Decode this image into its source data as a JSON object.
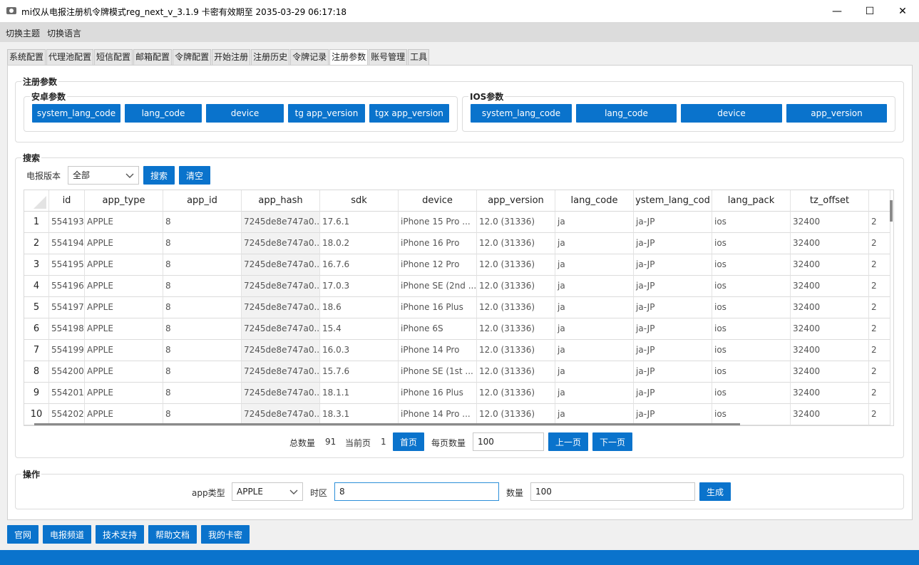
{
  "window": {
    "title": "mi仅从电报注册机令牌模式reg_next_v_3.1.9 卡密有效期至 2035-03-29 06:17:18",
    "minimize": "—",
    "maximize": "☐",
    "close": "✕"
  },
  "menu": [
    "切换主题",
    "切换语言"
  ],
  "tabs": [
    "系统配置",
    "代理池配置",
    "短信配置",
    "邮箱配置",
    "令牌配置",
    "开始注册",
    "注册历史",
    "令牌记录",
    "注册参数",
    "账号管理",
    "工具"
  ],
  "active_tab": "注册参数",
  "register_params": {
    "title": "注册参数",
    "android": {
      "title": "安卓参数",
      "buttons": [
        "system_lang_code",
        "lang_code",
        "device",
        "tg app_version",
        "tgx app_version"
      ]
    },
    "ios": {
      "title": "IOS参数",
      "buttons": [
        "system_lang_code",
        "lang_code",
        "device",
        "app_version"
      ]
    }
  },
  "search": {
    "title": "搜索",
    "version_label": "电报版本",
    "version_value": "全部",
    "search_button": "搜索",
    "clear_button": "清空"
  },
  "table": {
    "columns": [
      "id",
      "app_type",
      "app_id",
      "app_hash",
      "sdk",
      "device",
      "app_version",
      "lang_code",
      "ystem_lang_cod",
      "lang_pack",
      "tz_offset"
    ],
    "rows": [
      {
        "n": "1",
        "cells": [
          "554193",
          "APPLE",
          "8",
          "7245de8e747a0...",
          "17.6.1",
          "iPhone 15 Pro ...",
          "12.0 (31336)",
          "ja",
          "ja-JP",
          "ios",
          "32400",
          "2"
        ]
      },
      {
        "n": "2",
        "cells": [
          "554194",
          "APPLE",
          "8",
          "7245de8e747a0...",
          "18.0.2",
          "iPhone 16 Pro",
          "12.0 (31336)",
          "ja",
          "ja-JP",
          "ios",
          "32400",
          "2"
        ]
      },
      {
        "n": "3",
        "cells": [
          "554195",
          "APPLE",
          "8",
          "7245de8e747a0...",
          "16.7.6",
          "iPhone 12 Pro",
          "12.0 (31336)",
          "ja",
          "ja-JP",
          "ios",
          "32400",
          "2"
        ]
      },
      {
        "n": "4",
        "cells": [
          "554196",
          "APPLE",
          "8",
          "7245de8e747a0...",
          "17.0.3",
          "iPhone SE (2nd ...",
          "12.0 (31336)",
          "ja",
          "ja-JP",
          "ios",
          "32400",
          "2"
        ]
      },
      {
        "n": "5",
        "cells": [
          "554197",
          "APPLE",
          "8",
          "7245de8e747a0...",
          "18.6",
          "iPhone 16 Plus",
          "12.0 (31336)",
          "ja",
          "ja-JP",
          "ios",
          "32400",
          "2"
        ]
      },
      {
        "n": "6",
        "cells": [
          "554198",
          "APPLE",
          "8",
          "7245de8e747a0...",
          "15.4",
          "iPhone 6S",
          "12.0 (31336)",
          "ja",
          "ja-JP",
          "ios",
          "32400",
          "2"
        ]
      },
      {
        "n": "7",
        "cells": [
          "554199",
          "APPLE",
          "8",
          "7245de8e747a0...",
          "16.0.3",
          "iPhone 14 Pro",
          "12.0 (31336)",
          "ja",
          "ja-JP",
          "ios",
          "32400",
          "2"
        ]
      },
      {
        "n": "8",
        "cells": [
          "554200",
          "APPLE",
          "8",
          "7245de8e747a0...",
          "15.7.6",
          "iPhone SE (1st ...",
          "12.0 (31336)",
          "ja",
          "ja-JP",
          "ios",
          "32400",
          "2"
        ]
      },
      {
        "n": "9",
        "cells": [
          "554201",
          "APPLE",
          "8",
          "7245de8e747a0...",
          "18.1.1",
          "iPhone 16 Plus",
          "12.0 (31336)",
          "ja",
          "ja-JP",
          "ios",
          "32400",
          "2"
        ]
      },
      {
        "n": "10",
        "cells": [
          "554202",
          "APPLE",
          "8",
          "7245de8e747a0...",
          "18.3.1",
          "iPhone 14 Pro ...",
          "12.0 (31336)",
          "ja",
          "ja-JP",
          "ios",
          "32400",
          "2"
        ]
      }
    ]
  },
  "pagination": {
    "total_label": "总数量",
    "total": "91",
    "current_label": "当前页",
    "current": "1",
    "first_button": "首页",
    "page_size_label": "每页数量",
    "page_size": "100",
    "prev_button": "上一页",
    "next_button": "下一页"
  },
  "operation": {
    "title": "操作",
    "app_type_label": "app类型",
    "app_type_value": "APPLE",
    "timezone_label": "时区",
    "timezone_value": "8",
    "count_label": "数量",
    "count_value": "100",
    "generate_button": "生成"
  },
  "footer_buttons": [
    "官网",
    "电报频道",
    "技术支持",
    "帮助文档",
    "我的卡密"
  ],
  "colors": {
    "accent": "#0a73cc",
    "focus": "#2c8fd9"
  }
}
